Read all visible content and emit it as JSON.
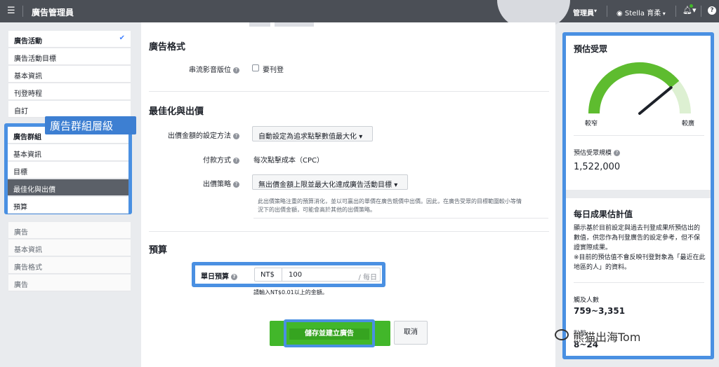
{
  "topbar": {
    "menu_icon": "hamburger-icon",
    "title": "廣告管理員",
    "role": "管理員",
    "user": "Stella 育柔",
    "help": "?"
  },
  "nav": {
    "campaign": [
      {
        "label": "廣告活動",
        "check": "✔"
      },
      {
        "label": "廣告活動目標"
      },
      {
        "label": "基本資訊"
      },
      {
        "label": "刊登時程"
      },
      {
        "label": "自訂"
      }
    ],
    "adset_callout": "廣告群組層級",
    "adset": [
      {
        "label": "廣告群組"
      },
      {
        "label": "基本資訊"
      },
      {
        "label": "目標"
      },
      {
        "label": "最佳化與出價"
      },
      {
        "label": "預算"
      }
    ],
    "ad": [
      {
        "label": "廣告"
      },
      {
        "label": "基本資訊"
      },
      {
        "label": "廣告格式"
      },
      {
        "label": "廣告"
      }
    ]
  },
  "main": {
    "format": {
      "title": "廣告格式",
      "placement_label": "串流影音版位",
      "placement_option": "要刊登"
    },
    "optimization": {
      "title": "最佳化與出價",
      "bid_method_label": "出價金額的設定方法",
      "bid_method_value": "自動設定為追求點擊數值最大化",
      "payment_label": "付款方式",
      "payment_value": "每次點擊成本（CPC）",
      "strategy_label": "出價策略",
      "strategy_value": "無出價金額上限並最大化達成廣告活動目標",
      "strategy_help_1": "此出價策略注重的預算消化，並以可贏出的單價在廣告競價中出價。因此，在廣告受眾的目標範圍較小等情",
      "strategy_help_2": "況下的出價金額，可能會高於其他的出價策略。"
    },
    "budget": {
      "title": "預算",
      "daily_label": "單日預算",
      "currency": "NT$",
      "amount": "100",
      "per": "/ 每日",
      "hint": "請輸入NT$0.01以上的金額。"
    },
    "save_label": "儲存並建立廣告",
    "cancel_label": "取消"
  },
  "right": {
    "audience_title": "預估受眾",
    "gauge": {
      "narrow": "較窄",
      "wide": "較廣",
      "level": 0.78
    },
    "size_label": "預估受眾規模",
    "size_value": "1,522,000",
    "daily_title": "每日成果估計值",
    "daily_desc_1": "顯示基於目前設定與過去刊登成果所預估出的數值，供您作為刊登廣告的設定參考，但不保證實際成果。",
    "daily_desc_2": "※目前的預估值不會反映刊登對象為「最近在此地區的人」的資料。",
    "reach_label": "觸及人數",
    "reach_value": "759~3,351",
    "clicks_label": "點擊",
    "clicks_value": "8~24"
  },
  "watermark": "熊猫出海Tom",
  "colors": {
    "highlight": "#4a90e2",
    "save_green": "#42b72a",
    "gauge_green": "#5ebc2f",
    "topbar": "#4b4f56"
  }
}
